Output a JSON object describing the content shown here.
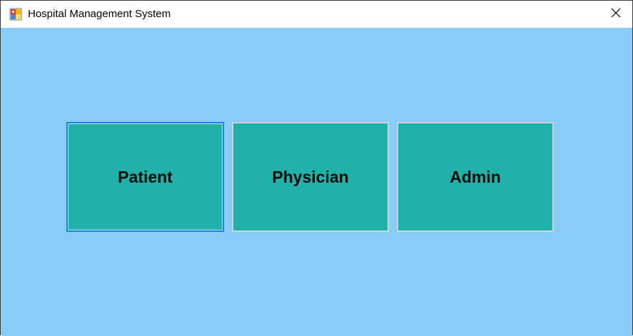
{
  "window": {
    "title": "Hospital Management System",
    "app_icon": "windows-form-icon",
    "close_icon": "close-icon"
  },
  "colors": {
    "client_background": "#87cdf8",
    "button_fill": "#20b2aa",
    "focus_border": "#1a7fe0"
  },
  "buttons": [
    {
      "label": "Patient",
      "focused": true
    },
    {
      "label": "Physician",
      "focused": false
    },
    {
      "label": "Admin",
      "focused": false
    }
  ]
}
